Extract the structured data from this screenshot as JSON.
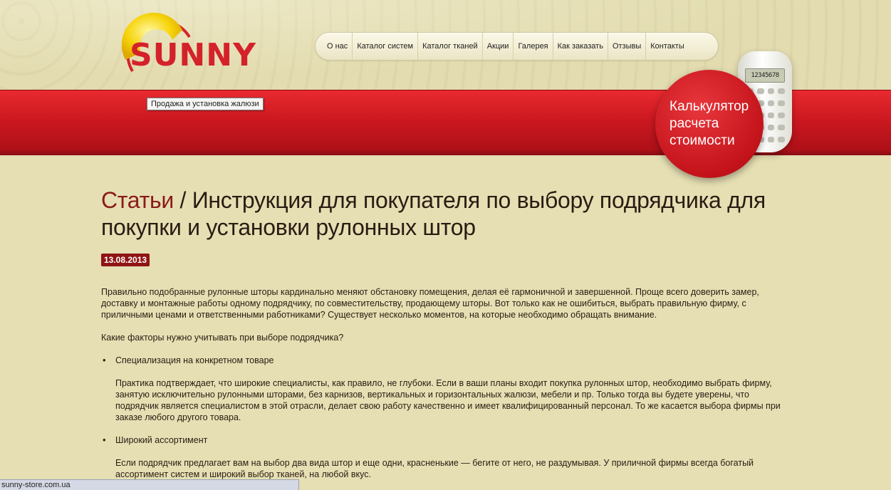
{
  "brand": {
    "logo_text": "SUNNY",
    "accent": "#d4222a",
    "sun_color": "#f6d40c"
  },
  "nav": {
    "items": [
      "О нас",
      "Каталог систем",
      "Каталог тканей",
      "Акции",
      "Галерея",
      "Как заказать",
      "Отзывы",
      "Контакты"
    ]
  },
  "tooltip": "Продажа и установка жалюзи",
  "calculator": {
    "screen": "12345678",
    "label": "Калькулятор расчета стоимости"
  },
  "article": {
    "breadcrumb": "Статьи",
    "separator": " / ",
    "title": "Инструкция для покупателя по выбору подрядчика для покупки и установки рулонных штор",
    "date": "13.08.2013",
    "intro": "Правильно подобранные рулонные шторы кардинально меняют обстановку помещения, делая её гармоничной и завершенной. Проще всего доверить замер, доставку и монтажные работы одному подрядчику, по совместительству, продающему шторы. Вот только как не ошибиться, выбрать правильную фирму, с приличными ценами и ответственными работниками? Существует несколько моментов, на которые необходимо обращать внимание.",
    "question": "Какие факторы нужно учитывать при выборе подрядчика?",
    "factors": [
      {
        "title": "Специализация на конкретном товаре",
        "text": "Практика подтверждает, что широкие специалисты, как правило, не глубоки. Если в ваши планы входит покупка рулонных штор, необходимо выбрать фирму, занятую исключительно рулонными шторами, без карнизов, вертикальных и горизонтальных жалюзи, мебели и пр. Только тогда вы будете уверены, что подрядчик является специалистом в этой отрасли, делает свою работу качественно и имеет квалифицированный персонал. То же касается выбора фирмы при заказе любого другого товара."
      },
      {
        "title": "Широкий ассортимент",
        "text": "Если подрядчик предлагает вам на выбор два вида штор и еще одни, красненькие — бегите от него, не раздумывая. У приличной фирмы всегда богатый ассортимент систем и широкий выбор тканей, на любой вкус."
      }
    ]
  },
  "statusbar": "sunny-store.com.ua"
}
